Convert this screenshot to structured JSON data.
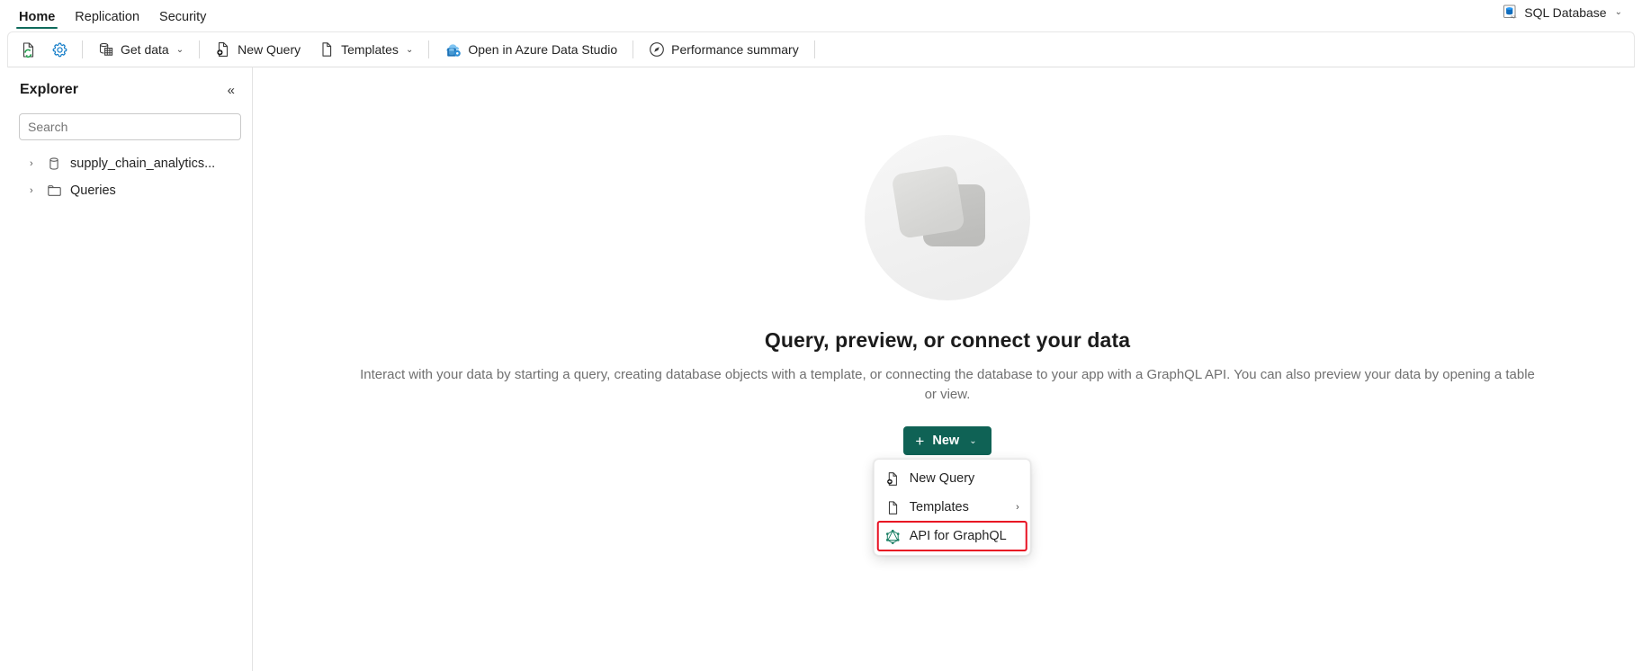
{
  "window": {
    "db_badge": {
      "label": "SQL Database",
      "icon": "sql-database-icon",
      "chevron": "⌄"
    }
  },
  "ribbon": {
    "tabs": [
      {
        "label": "Home",
        "active": true
      },
      {
        "label": "Replication",
        "active": false
      },
      {
        "label": "Security",
        "active": false
      }
    ]
  },
  "toolbar": {
    "refresh_icon": "refresh-document-icon",
    "settings_icon": "gear-icon",
    "items": [
      {
        "label": "Get data",
        "icon": "get-data-icon",
        "has_chevron": true
      },
      {
        "label": "New Query",
        "icon": "new-query-icon",
        "has_chevron": false
      },
      {
        "label": "Templates",
        "icon": "templates-icon",
        "has_chevron": true
      },
      {
        "label": "Open in Azure Data Studio",
        "icon": "azure-data-studio-icon",
        "has_chevron": false
      },
      {
        "label": "Performance summary",
        "icon": "performance-icon",
        "has_chevron": false
      }
    ],
    "chevron": "⌄"
  },
  "explorer": {
    "title": "Explorer",
    "collapse_icon": "«",
    "search": {
      "placeholder": "Search",
      "value": ""
    },
    "items": [
      {
        "label": "supply_chain_analytics...",
        "icon": "database-icon",
        "chevron": "›"
      },
      {
        "label": "Queries",
        "icon": "folder-icon",
        "chevron": "›"
      }
    ]
  },
  "main": {
    "illustration": "data-cards-illustration",
    "title": "Query, preview, or connect your data",
    "description": "Interact with your data by starting a query, creating database objects with a template, or connecting the database to your app with a GraphQL API. You can also preview your data by opening a table or view.",
    "new_button": {
      "label": "New",
      "plus": "+",
      "chevron": "⌄"
    },
    "menu": {
      "items": [
        {
          "label": "New Query",
          "icon": "new-query-icon",
          "submenu": false,
          "highlighted": false
        },
        {
          "label": "Templates",
          "icon": "templates-icon",
          "submenu": true,
          "submenu_chevron": "›",
          "highlighted": false
        },
        {
          "label": "API for GraphQL",
          "icon": "graphql-icon",
          "submenu": false,
          "highlighted": true
        }
      ]
    }
  },
  "colors": {
    "accent_green": "#0f6255",
    "tab_underline": "#0f6b5c",
    "highlight_red": "#e81123",
    "graphql": "#1a7f64"
  }
}
